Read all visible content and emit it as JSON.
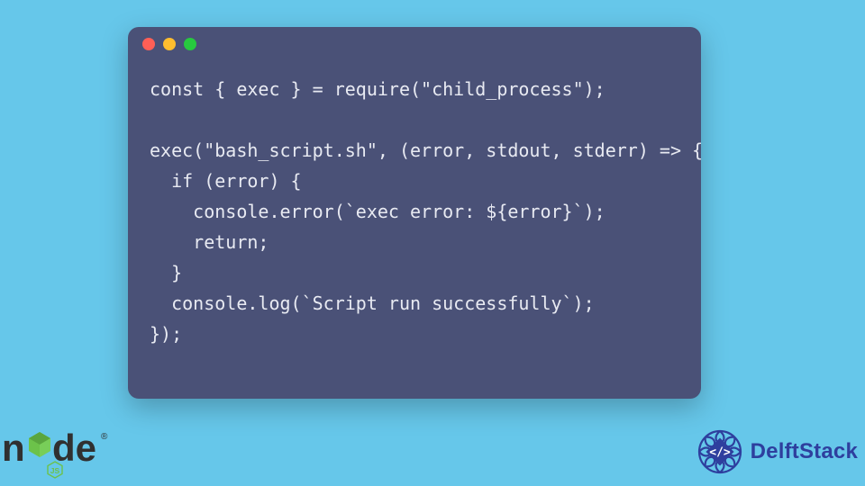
{
  "code": {
    "lines": [
      "const { exec } = require(\"child_process\");",
      "",
      "exec(\"bash_script.sh\", (error, stdout, stderr) => {",
      "  if (error) {",
      "    console.error(`exec error: ${error}`);",
      "    return;",
      "  }",
      "  console.log(`Script run successfully`);",
      "});"
    ]
  },
  "branding": {
    "node_text": "node",
    "delftstack_text": "DelftStack"
  },
  "colors": {
    "page_bg": "#66c7ea",
    "window_bg": "#4a5177",
    "code_fg": "#e8eaf2",
    "traffic_red": "#ff5f56",
    "traffic_yellow": "#ffbd2e",
    "traffic_green": "#27c93f",
    "node_dark": "#303030",
    "node_green": "#6cc24a",
    "delft_blue": "#2e3f9e"
  }
}
